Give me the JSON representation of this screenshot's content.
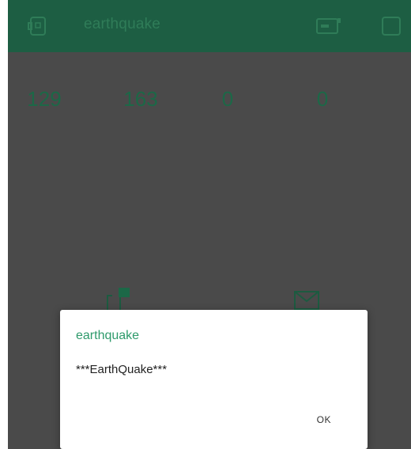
{
  "header": {
    "title": "earthquake",
    "icons": [
      "device-icon",
      "battery-icon",
      "square-icon"
    ],
    "background": "#1d5e43",
    "title_color": "#2f7c58"
  },
  "counters": [
    "129",
    "163",
    "0",
    "0"
  ],
  "widgets": [
    "flag-icon",
    "mail-icon"
  ],
  "dialog": {
    "title": "earthquake",
    "message": "***EarthQuake***",
    "ok_label": "OK",
    "accent": "#2e9a6b"
  }
}
